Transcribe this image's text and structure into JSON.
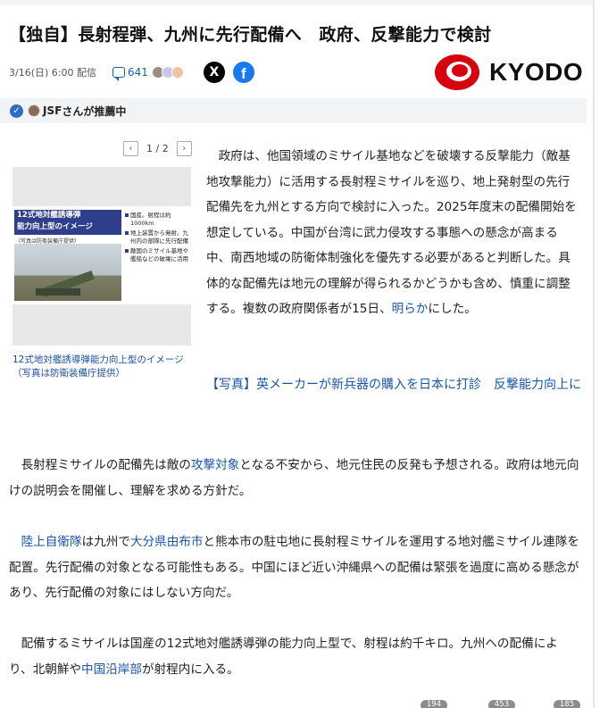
{
  "article": {
    "title": "【独自】長射程弾、九州に先行配備へ　政府、反撃能力で検討",
    "date": "3/16(日) 6:00 配信",
    "comment_count": "641",
    "share_x": "X",
    "share_facebook": "f",
    "publisher": "KYODO",
    "recommend_user": "JSF",
    "recommend_text": "さんが推薦中"
  },
  "gallery": {
    "prev": "‹",
    "next": "›",
    "page": "1 / 2",
    "image_title_line1": "12式地対艦誘導弾",
    "image_title_line2": "能力向上型のイメージ",
    "image_sub": "（写真は防衛装備庁提供）",
    "image_bullets": [
      "国産。射程は約1000km",
      "地上装置から発射。九州内の部隊に先行配備",
      "敵国のミサイル基地や艦船などの破壊に活用"
    ],
    "caption": "12式地対艦誘導弾能力向上型のイメージ（写真は防衛装備庁提供）"
  },
  "body": {
    "p1": "　政府は、他国領域のミサイル基地などを破壊する反撃能力（敵基地攻撃能力）に活用する長射程ミサイルを巡り、地上発射型の先行配備先を九州とする方向で検討に入った。2025年度末の配備開始を想定している。中国が台湾に武力侵攻する事態への懸念が高まる中、南西地域の防衛体制強化を優先する必要があると判断した。具体的な配備先は地元の理解が得られるかどうかも含め、慎重に調整する。複数の政府関係者が15日、",
    "p1_link": "明らか",
    "p1_end": "にした。",
    "related_link": "【写真】英メーカーが新兵器の購入を日本に打診　反撃能力向上に",
    "p3_a": "　長射程ミサイルの配備先は敵の",
    "p3_link": "攻撃対象",
    "p3_b": "となる不安から、地元住民の反発も予想される。政府は地元向けの説明会を開催し、理解を求める方針だ。",
    "p4_pre": "　",
    "p4_link1": "陸上自衛隊",
    "p4_a": "は九州で",
    "p4_link2": "大分県由布市",
    "p4_b": "と熊本市の駐屯地に長射程ミサイルを運用する地対艦ミサイル連隊を配置。先行配備の対象となる可能性もある。中国にほど近い沖縄県への配備は緊張を過度に高める懸念があり、先行配備の対象にはしない方向だ。",
    "p5_a": "　配備するミサイルは国産の12式地対艦誘導弾の能力向上型で、射程は約千キロ。九州への配備により、北朝鮮や",
    "p5_link": "中国沿岸部",
    "p5_b": "が射程内に入る。"
  },
  "reactions": [
    "194",
    "453",
    "185"
  ],
  "colors": {
    "link": "#1a55a8",
    "kyodo_red": "#d7000f",
    "facebook": "#1877f2"
  }
}
